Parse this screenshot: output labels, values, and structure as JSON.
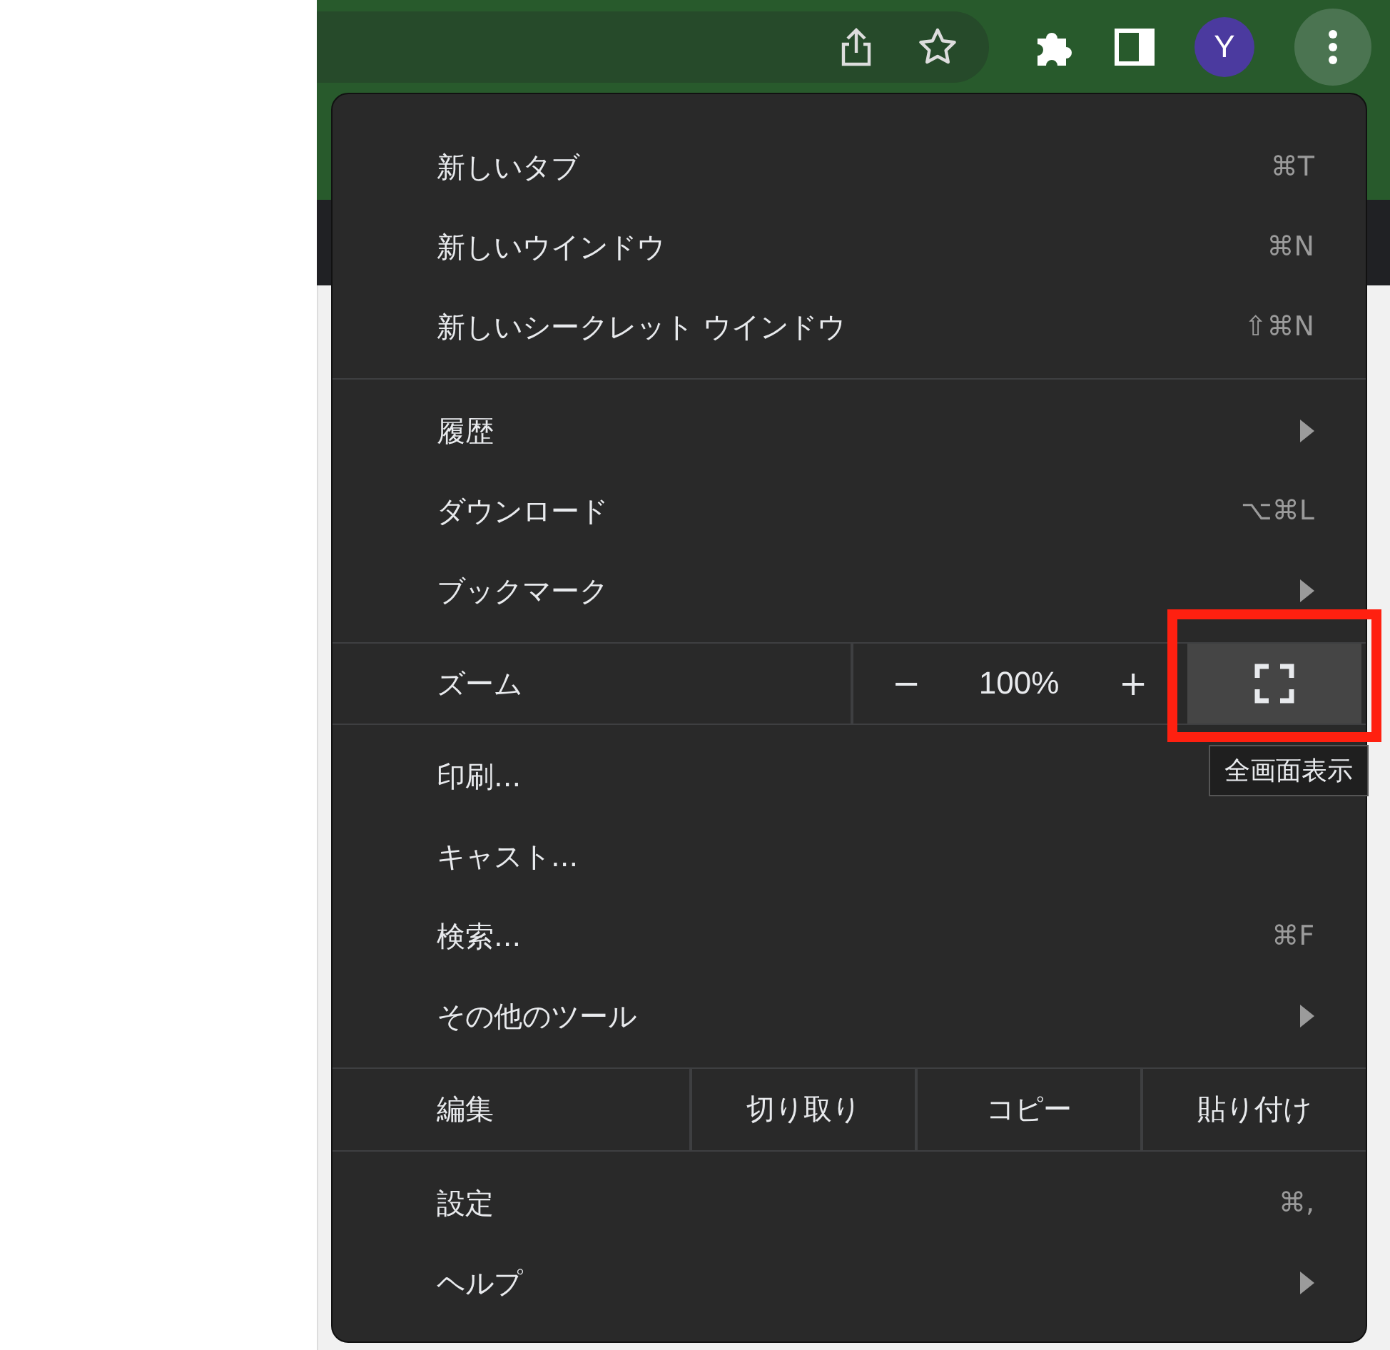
{
  "toolbar": {
    "avatar": "Y"
  },
  "menu": {
    "sections": [
      {
        "kind": "items",
        "items": [
          {
            "label": "新しいタブ",
            "shortcut": "⌘T",
            "submenu": false
          },
          {
            "label": "新しいウインドウ",
            "shortcut": "⌘N",
            "submenu": false
          },
          {
            "label": "新しいシークレット ウインドウ",
            "shortcut": "⇧⌘N",
            "submenu": false
          }
        ]
      },
      {
        "kind": "items",
        "items": [
          {
            "label": "履歴",
            "submenu": true
          },
          {
            "label": "ダウンロード",
            "shortcut": "⌥⌘L",
            "submenu": false
          },
          {
            "label": "ブックマーク",
            "submenu": true
          }
        ]
      },
      {
        "kind": "zoom",
        "label": "ズーム",
        "minus": "−",
        "value": "100%",
        "plus": "+",
        "fullscreen_highlighted": true
      },
      {
        "kind": "items",
        "items": [
          {
            "label": "印刷..."
          },
          {
            "label": "キャスト...",
            "submenu": false
          },
          {
            "label": "検索...",
            "shortcut": "⌘F",
            "submenu": false
          },
          {
            "label": "その他のツール",
            "submenu": true
          }
        ]
      },
      {
        "kind": "edit",
        "label": "編集",
        "actions": [
          "切り取り",
          "コピー",
          "貼り付け"
        ]
      },
      {
        "kind": "items",
        "items": [
          {
            "label": "設定",
            "shortcut": "⌘,",
            "submenu": false
          },
          {
            "label": "ヘルプ",
            "submenu": true
          }
        ]
      }
    ]
  },
  "tooltip": "全画面表示"
}
